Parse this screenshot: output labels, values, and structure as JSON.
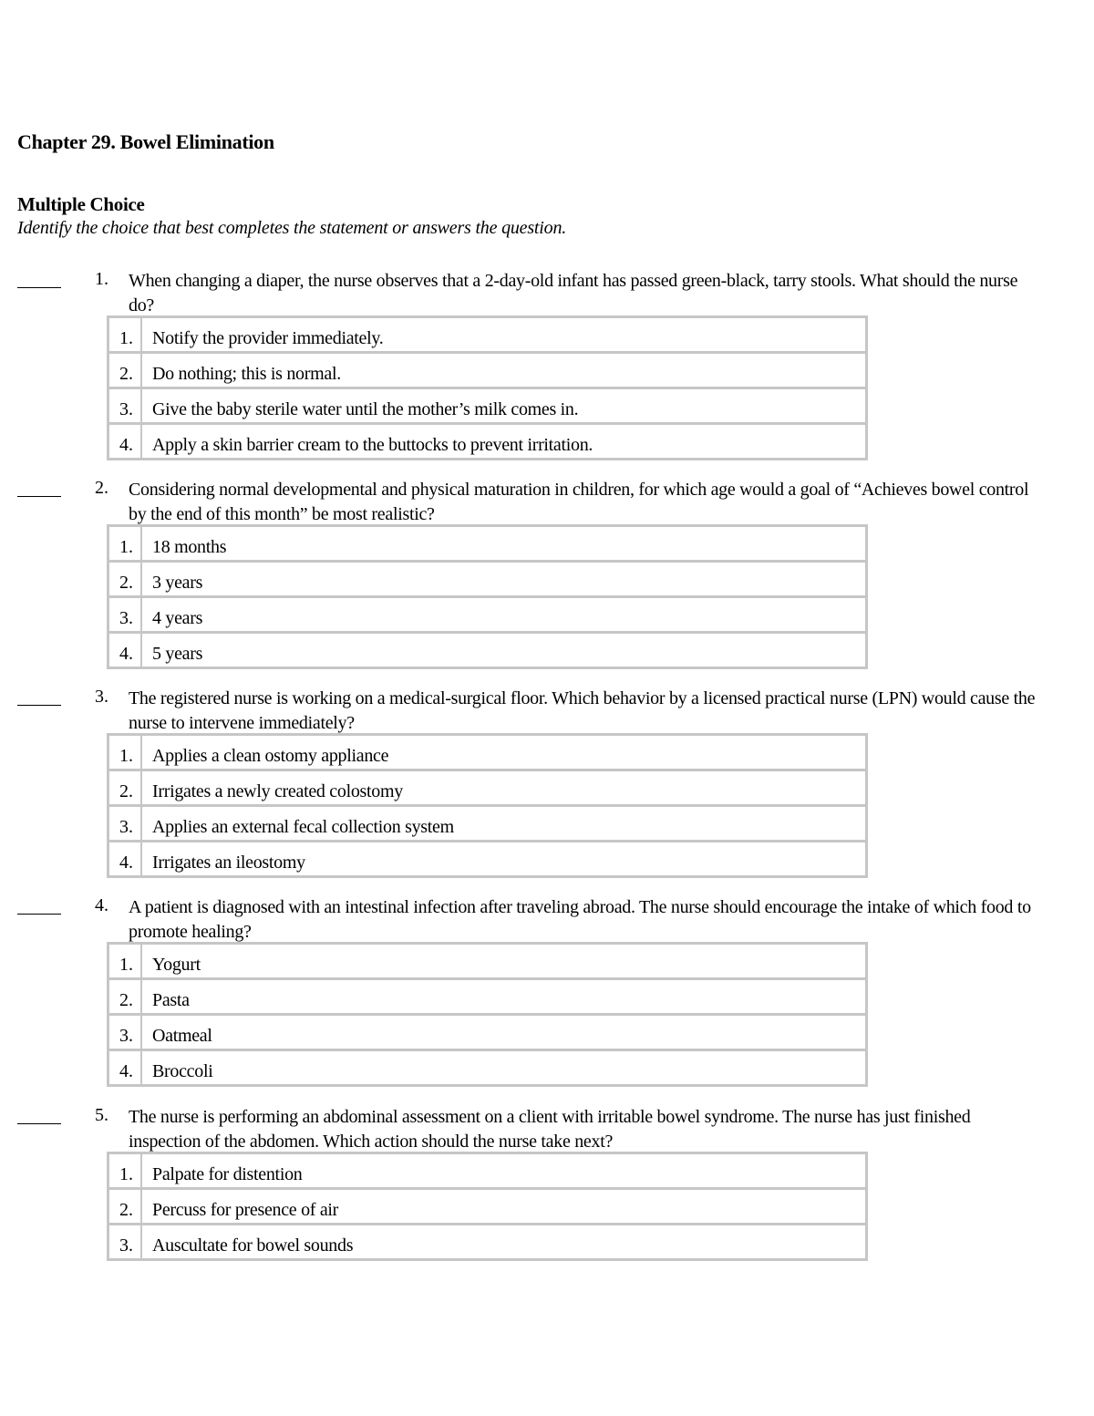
{
  "document": {
    "chapter_title": "Chapter 29. Bowel Elimination",
    "section_title": "Multiple Choice",
    "instructions": "Identify the choice that best completes the statement or answers the question."
  },
  "questions": [
    {
      "number": "1.",
      "stem": "When changing a diaper, the nurse observes that a 2-day-old infant has passed green-black, tarry stools. What should the nurse do?",
      "choices": [
        {
          "number": "1.",
          "text": "Notify the provider immediately."
        },
        {
          "number": "2.",
          "text": "Do nothing; this is normal."
        },
        {
          "number": "3.",
          "text": "Give the baby sterile water until the mother’s milk comes in."
        },
        {
          "number": "4.",
          "text": "Apply a skin barrier cream to the buttocks to prevent irritation."
        }
      ]
    },
    {
      "number": "2.",
      "stem": "Considering normal developmental and physical maturation in children, for which age would a goal of “Achieves bowel control by the end of this month” be most realistic?",
      "choices": [
        {
          "number": "1.",
          "text": "18 months"
        },
        {
          "number": "2.",
          "text": "3 years"
        },
        {
          "number": "3.",
          "text": "4 years"
        },
        {
          "number": "4.",
          "text": "5 years"
        }
      ]
    },
    {
      "number": "3.",
      "stem": "The registered nurse is working on a medical-surgical floor. Which behavior by a licensed practical nurse (LPN) would cause the nurse to intervene immediately?",
      "choices": [
        {
          "number": "1.",
          "text": "Applies a clean ostomy appliance"
        },
        {
          "number": "2.",
          "text": "Irrigates a newly created colostomy"
        },
        {
          "number": "3.",
          "text": "Applies an external fecal collection system"
        },
        {
          "number": "4.",
          "text": "Irrigates an ileostomy"
        }
      ]
    },
    {
      "number": "4.",
      "stem": "A patient is diagnosed with an intestinal infection after traveling abroad. The nurse should encourage the intake of which food to promote healing?",
      "choices": [
        {
          "number": "1.",
          "text": "Yogurt"
        },
        {
          "number": "2.",
          "text": "Pasta"
        },
        {
          "number": "3.",
          "text": "Oatmeal"
        },
        {
          "number": "4.",
          "text": "Broccoli"
        }
      ]
    },
    {
      "number": "5.",
      "stem": "The nurse is performing an abdominal assessment on a client with irritable bowel syndrome. The nurse has just finished inspection of the abdomen. Which action should the nurse take next?",
      "choices": [
        {
          "number": "1.",
          "text": "Palpate for distention"
        },
        {
          "number": "2.",
          "text": "Percuss for presence of air"
        },
        {
          "number": "3.",
          "text": "Auscultate for bowel sounds"
        }
      ]
    }
  ]
}
